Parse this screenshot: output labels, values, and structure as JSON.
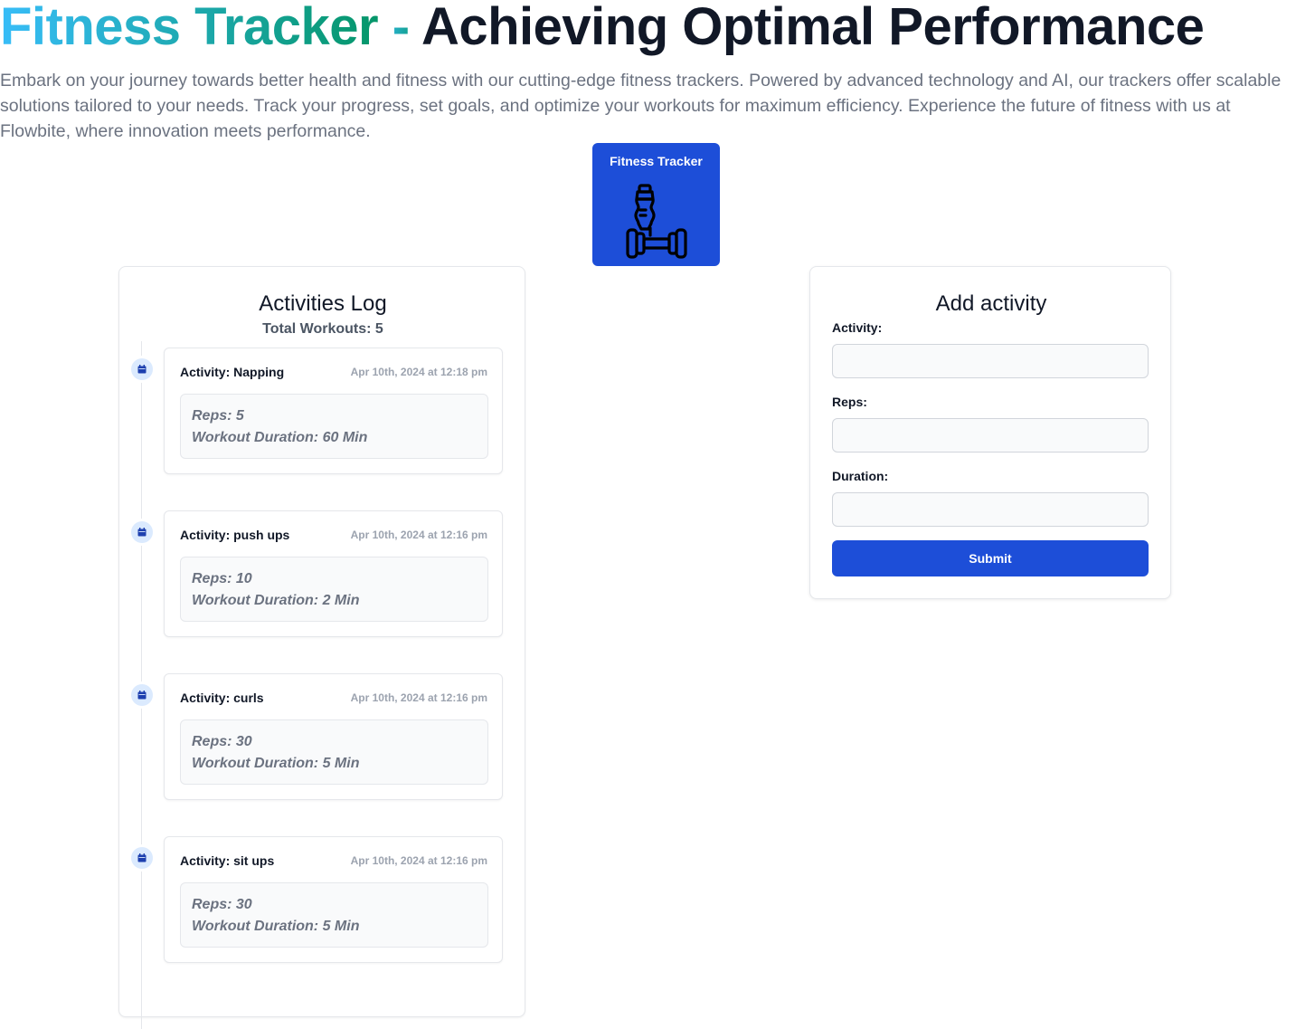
{
  "hero": {
    "title_gradient": "Fitness Tracker",
    "title_dash": " - ",
    "title_rest": "Achieving Optimal Performance",
    "description": "Embark on your journey towards better health and fitness with our cutting-edge fitness trackers. Powered by advanced technology and AI, our trackers offer scalable solutions tailored to your needs. Track your progress, set goals, and optimize your workouts for maximum efficiency. Experience the future of fitness with us at Flowbite, where innovation meets performance."
  },
  "logo": {
    "title": "Fitness Tracker",
    "icon": "fitness-bottle-dumbbell-icon"
  },
  "log": {
    "title": "Activities Log",
    "total": "Total Workouts: 5",
    "items": [
      {
        "activity": "Activity: Napping",
        "time": "Apr 10th, 2024 at 12:18 pm",
        "reps": "Reps: 5",
        "duration": "Workout Duration: 60 Min"
      },
      {
        "activity": "Activity: push ups",
        "time": "Apr 10th, 2024 at 12:16 pm",
        "reps": "Reps: 10",
        "duration": "Workout Duration: 2 Min"
      },
      {
        "activity": "Activity: curls",
        "time": "Apr 10th, 2024 at 12:16 pm",
        "reps": "Reps: 30",
        "duration": "Workout Duration: 5 Min"
      },
      {
        "activity": "Activity: sit ups",
        "time": "Apr 10th, 2024 at 12:16 pm",
        "reps": "Reps: 30",
        "duration": "Workout Duration: 5 Min"
      }
    ]
  },
  "form": {
    "title": "Add activity",
    "activity_label": "Activity:",
    "activity_value": "",
    "reps_label": "Reps:",
    "reps_value": "",
    "duration_label": "Duration:",
    "duration_value": "",
    "submit_label": "Submit"
  },
  "colors": {
    "accent": "#1d4ed8",
    "gradient_start": "#38bdf8",
    "gradient_end": "#059669",
    "timeline_dot": "#dbeafe"
  }
}
